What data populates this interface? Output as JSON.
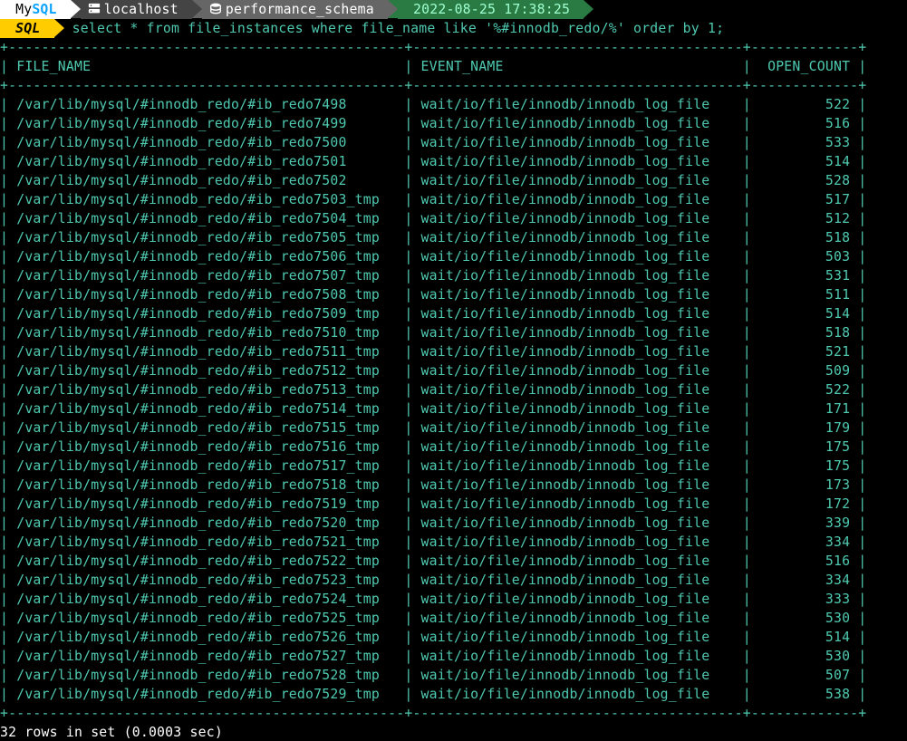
{
  "prompt": {
    "brand_prefix": "My",
    "brand_suffix": "SQL",
    "host": "localhost",
    "schema": "performance_schema",
    "timestamp": "2022-08-25 17:38:25",
    "mode": "SQL"
  },
  "query": "select * from file_instances where file_name like '%#innodb_redo/%' order by 1;",
  "headers": [
    "FILE_NAME",
    "EVENT_NAME",
    "OPEN_COUNT"
  ],
  "rows": [
    {
      "file": "/var/lib/mysql/#innodb_redo/#ib_redo7498",
      "event": "wait/io/file/innodb/innodb_log_file",
      "count": 522
    },
    {
      "file": "/var/lib/mysql/#innodb_redo/#ib_redo7499",
      "event": "wait/io/file/innodb/innodb_log_file",
      "count": 516
    },
    {
      "file": "/var/lib/mysql/#innodb_redo/#ib_redo7500",
      "event": "wait/io/file/innodb/innodb_log_file",
      "count": 533
    },
    {
      "file": "/var/lib/mysql/#innodb_redo/#ib_redo7501",
      "event": "wait/io/file/innodb/innodb_log_file",
      "count": 514
    },
    {
      "file": "/var/lib/mysql/#innodb_redo/#ib_redo7502",
      "event": "wait/io/file/innodb/innodb_log_file",
      "count": 528
    },
    {
      "file": "/var/lib/mysql/#innodb_redo/#ib_redo7503_tmp",
      "event": "wait/io/file/innodb/innodb_log_file",
      "count": 517
    },
    {
      "file": "/var/lib/mysql/#innodb_redo/#ib_redo7504_tmp",
      "event": "wait/io/file/innodb/innodb_log_file",
      "count": 512
    },
    {
      "file": "/var/lib/mysql/#innodb_redo/#ib_redo7505_tmp",
      "event": "wait/io/file/innodb/innodb_log_file",
      "count": 518
    },
    {
      "file": "/var/lib/mysql/#innodb_redo/#ib_redo7506_tmp",
      "event": "wait/io/file/innodb/innodb_log_file",
      "count": 503
    },
    {
      "file": "/var/lib/mysql/#innodb_redo/#ib_redo7507_tmp",
      "event": "wait/io/file/innodb/innodb_log_file",
      "count": 531
    },
    {
      "file": "/var/lib/mysql/#innodb_redo/#ib_redo7508_tmp",
      "event": "wait/io/file/innodb/innodb_log_file",
      "count": 511
    },
    {
      "file": "/var/lib/mysql/#innodb_redo/#ib_redo7509_tmp",
      "event": "wait/io/file/innodb/innodb_log_file",
      "count": 514
    },
    {
      "file": "/var/lib/mysql/#innodb_redo/#ib_redo7510_tmp",
      "event": "wait/io/file/innodb/innodb_log_file",
      "count": 518
    },
    {
      "file": "/var/lib/mysql/#innodb_redo/#ib_redo7511_tmp",
      "event": "wait/io/file/innodb/innodb_log_file",
      "count": 521
    },
    {
      "file": "/var/lib/mysql/#innodb_redo/#ib_redo7512_tmp",
      "event": "wait/io/file/innodb/innodb_log_file",
      "count": 509
    },
    {
      "file": "/var/lib/mysql/#innodb_redo/#ib_redo7513_tmp",
      "event": "wait/io/file/innodb/innodb_log_file",
      "count": 522
    },
    {
      "file": "/var/lib/mysql/#innodb_redo/#ib_redo7514_tmp",
      "event": "wait/io/file/innodb/innodb_log_file",
      "count": 171
    },
    {
      "file": "/var/lib/mysql/#innodb_redo/#ib_redo7515_tmp",
      "event": "wait/io/file/innodb/innodb_log_file",
      "count": 179
    },
    {
      "file": "/var/lib/mysql/#innodb_redo/#ib_redo7516_tmp",
      "event": "wait/io/file/innodb/innodb_log_file",
      "count": 175
    },
    {
      "file": "/var/lib/mysql/#innodb_redo/#ib_redo7517_tmp",
      "event": "wait/io/file/innodb/innodb_log_file",
      "count": 175
    },
    {
      "file": "/var/lib/mysql/#innodb_redo/#ib_redo7518_tmp",
      "event": "wait/io/file/innodb/innodb_log_file",
      "count": 173
    },
    {
      "file": "/var/lib/mysql/#innodb_redo/#ib_redo7519_tmp",
      "event": "wait/io/file/innodb/innodb_log_file",
      "count": 172
    },
    {
      "file": "/var/lib/mysql/#innodb_redo/#ib_redo7520_tmp",
      "event": "wait/io/file/innodb/innodb_log_file",
      "count": 339
    },
    {
      "file": "/var/lib/mysql/#innodb_redo/#ib_redo7521_tmp",
      "event": "wait/io/file/innodb/innodb_log_file",
      "count": 334
    },
    {
      "file": "/var/lib/mysql/#innodb_redo/#ib_redo7522_tmp",
      "event": "wait/io/file/innodb/innodb_log_file",
      "count": 516
    },
    {
      "file": "/var/lib/mysql/#innodb_redo/#ib_redo7523_tmp",
      "event": "wait/io/file/innodb/innodb_log_file",
      "count": 334
    },
    {
      "file": "/var/lib/mysql/#innodb_redo/#ib_redo7524_tmp",
      "event": "wait/io/file/innodb/innodb_log_file",
      "count": 333
    },
    {
      "file": "/var/lib/mysql/#innodb_redo/#ib_redo7525_tmp",
      "event": "wait/io/file/innodb/innodb_log_file",
      "count": 530
    },
    {
      "file": "/var/lib/mysql/#innodb_redo/#ib_redo7526_tmp",
      "event": "wait/io/file/innodb/innodb_log_file",
      "count": 514
    },
    {
      "file": "/var/lib/mysql/#innodb_redo/#ib_redo7527_tmp",
      "event": "wait/io/file/innodb/innodb_log_file",
      "count": 530
    },
    {
      "file": "/var/lib/mysql/#innodb_redo/#ib_redo7528_tmp",
      "event": "wait/io/file/innodb/innodb_log_file",
      "count": 507
    },
    {
      "file": "/var/lib/mysql/#innodb_redo/#ib_redo7529_tmp",
      "event": "wait/io/file/innodb/innodb_log_file",
      "count": 538
    }
  ],
  "footer": "32 rows in set (0.0003 sec)",
  "col_widths": {
    "file": 46,
    "event": 38,
    "count": 11
  }
}
